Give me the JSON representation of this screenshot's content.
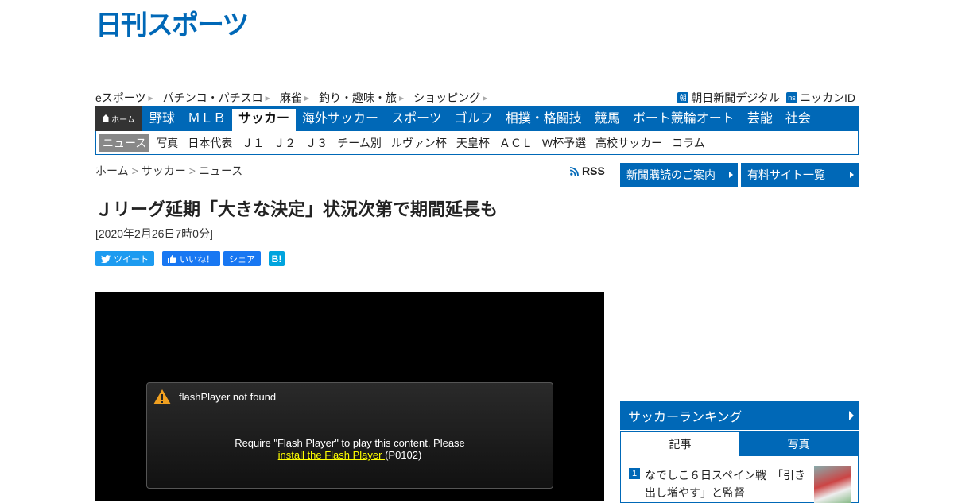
{
  "brand": {
    "logo_text": "日刊スポーツ",
    "color": "#0068b7"
  },
  "toplinks": {
    "left": [
      "eスポーツ",
      "パチンコ・パチスロ",
      "麻雀",
      "釣り・趣味・旅",
      "ショッピング"
    ],
    "right": [
      {
        "badge": "朝",
        "label": "朝日新聞デジタル"
      },
      {
        "badge": "ns",
        "label": "ニッカンID"
      }
    ]
  },
  "gnav": {
    "home_label": "ホーム",
    "items": [
      "野球",
      "ＭＬＢ",
      "サッカー",
      "海外サッカー",
      "スポーツ",
      "ゴルフ",
      "相撲・格闘技",
      "競馬",
      "ボート競輪オート",
      "芸能",
      "社会"
    ],
    "active": "サッカー"
  },
  "subnav": {
    "items": [
      "ニュース",
      "写真",
      "日本代表",
      "Ｊ１",
      "Ｊ２",
      "Ｊ３",
      "チーム別",
      "ルヴァン杯",
      "天皇杯",
      "ＡＣＬ",
      "W杯予選",
      "高校サッカー",
      "コラム"
    ],
    "active": "ニュース"
  },
  "breadcrumb": {
    "items": [
      "ホーム",
      "サッカー",
      "ニュース"
    ],
    "separator": ">"
  },
  "rss_label": "RSS",
  "article": {
    "title": "Ｊリーグ延期「大きな決定」状況次第で期間延長も",
    "date": "[2020年2月26日7時0分]"
  },
  "share": {
    "tweet": "ツイート",
    "like": "いいね！",
    "share": "シェア",
    "hatena": "B!"
  },
  "video": {
    "error_title": "flashPlayer not found",
    "message_line1": "Require \"Flash Player\" to play this content. Please",
    "link_text": "install the Flash Player ",
    "code": "(P0102)"
  },
  "sidebar": {
    "buttons": [
      "新聞購読のご案内",
      "有料サイト一覧"
    ],
    "ranking": {
      "title": "サッカーランキング",
      "tabs": [
        "記事",
        "写真"
      ],
      "items": [
        {
          "rank": "1",
          "text": "なでしこ６日スペイン戦　「引き出し増やす」と監督"
        }
      ]
    }
  }
}
